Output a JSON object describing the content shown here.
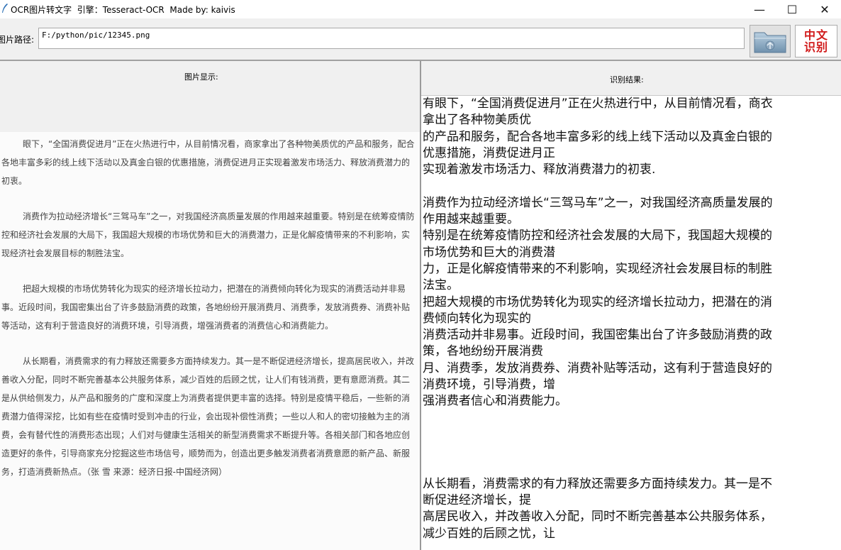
{
  "window": {
    "title": "OCR图片转文字  引擎：Tesseract-OCR  Made by: kaivis",
    "controls": {
      "minimize": "—",
      "maximize": "☐",
      "close": "✕"
    }
  },
  "toolbar": {
    "path_label": "图片路径:",
    "path_value": "F:/python/pic/12345.png",
    "folder_button_icon": "folder-open-icon",
    "ocr_button_label": "中文\n识别",
    "ocr_button_color": "#d11a1a"
  },
  "left_panel": {
    "header": "图片显示:",
    "image_paragraphs": [
      "眼下，“全国消费促进月”正在火热进行中，从目前情况看，商家拿出了各种物美质优的产品和服务，配合各地丰富多彩的线上线下活动以及真金白银的优惠措施，消费促进月正实现着激发市场活力、释放消费潜力的初衷。",
      "消费作为拉动经济增长“三驾马车”之一，对我国经济高质量发展的作用越来越重要。特别是在统筹疫情防控和经济社会发展的大局下，我国超大规模的市场优势和巨大的消费潜力，正是化解疫情带来的不利影响，实现经济社会发展目标的制胜法宝。",
      "把超大规模的市场优势转化为现实的经济增长拉动力，把潜在的消费倾向转化为现实的消费活动并非易事。近段时间，我国密集出台了许多鼓励消费的政策，各地纷纷开展消费月、消费季，发放消费券、消费补贴等活动，这有利于营造良好的消费环境，引导消费，增强消费者的消费信心和消费能力。",
      "从长期看，消费需求的有力释放还需要多方面持续发力。其一是不断促进经济增长，提高居民收入，并改善收入分配，同时不断完善基本公共服务体系，减少百姓的后顾之忧，让人们有钱消费，更有意愿消费。其二是从供给侧发力，从产品和服务的广度和深度上为消费者提供更丰富的选择。特别是疫情平稳后，一些新的消费潜力值得深挖，比如有些在疫情时受到冲击的行业，会出现补偿性消费；一些以人和人的密切接触为主的消费，会有替代性的消费形态出现；人们对与健康生活相关的新型消费需求不断提升等。各相关部门和各地应创造更好的条件，引导商家充分挖掘这些市场信号，顺势而为，创造出更多触发消费者消费意愿的新产品、新服务，打造消费新热点。（张 雪 来源：经济日报-中国经济网）"
    ]
  },
  "right_panel": {
    "header": "识别结果:",
    "result_lines": [
      "有眼下，“全国消费促进月”正在火热进行中，从目前情况看，商衣",
      "拿出了各种物美质优",
      "的产品和服务，配合各地丰富多彩的线上线下活动以及真金白银的",
      "优惠措施，消费促进月正",
      "实现着激发市场活力、释放消费潜力的初衷.",
      "",
      "消费作为拉动经济增长“三驾马车”之一，对我国经济高质量发展的",
      "作用越来越重要。",
      "特别是在统筹疫情防控和经济社会发展的大局下，我国超大规模的",
      "市场优势和巨大的消费潜",
      "力，正是化解疫情带来的不利影响，实现经济社会发展目标的制胜",
      "法宝。",
      "把超大规模的市场优势转化为现实的经济增长拉动力，把潜在的消",
      "费倾向转化为现实的",
      "消费活动并非易事。近段时间，我国密集出台了许多鼓励消费的政",
      "策，各地纷纷开展消费",
      "月、消费季，发放消费券、消费补贴等活动，这有利于营造良好的",
      "消费环境，引导消费，增",
      "强消费者信心和消费能力。",
      "",
      "",
      "",
      "",
      "从长期看，消费需求的有力释放还需要多方面持续发力。其一是不",
      "断促进经济增长，提",
      "高居民收入，并改善收入分配，同时不断完善基本公共服务体系，",
      "减少百姓的后顾之忧，让"
    ]
  }
}
